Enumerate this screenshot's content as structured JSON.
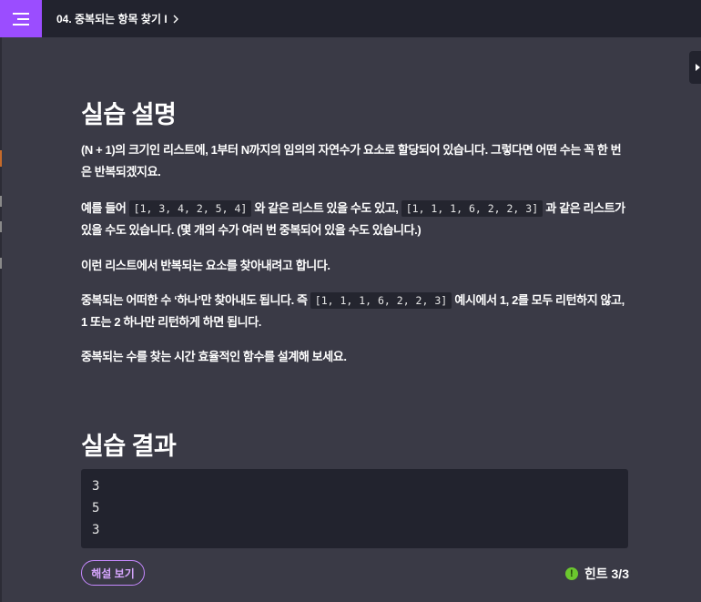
{
  "header": {
    "menu_icon": "hamburger-menu-icon",
    "breadcrumb_title": "04. 중복되는 항목 찾기 I",
    "breadcrumb_chevron": "›"
  },
  "description": {
    "heading": "실습 설명",
    "p1": "(N + 1)의 크기인 리스트에, 1부터 N까지의 임의의 자연수가 요소로 할당되어 있습니다. 그렇다면 어떤 수는 꼭 한 번은 반복되겠지요.",
    "p2_pre": "예를 들어",
    "p2_code1": "[1, 3, 4, 2, 5, 4]",
    "p2_mid": "와 같은 리스트 있을 수도 있고,",
    "p2_code2": "[1, 1, 1, 6, 2, 2, 3]",
    "p2_post": "과 같은 리스트가 있을 수도 있습니다. (몇 개의 수가 여러 번 중복되어 있을 수도 있습니다.)",
    "p3": "이런 리스트에서 반복되는 요소를 찾아내려고 합니다.",
    "p4_pre": "중복되는 어떠한 수 ‘하나’만 찾아내도 됩니다. 즉",
    "p4_code": "[1, 1, 1, 6, 2, 2, 3]",
    "p4_post": "예시에서 1, 2를 모두 리턴하지 않고, 1 또는 2 하나만 리턴하게 하면 됩니다.",
    "p5": "중복되는 수를 찾는 시간 효율적인 함수를 설계해 보세요."
  },
  "result": {
    "heading": "실습 결과",
    "lines": [
      "3",
      "5",
      "3"
    ]
  },
  "footer": {
    "solution_button": "해설 보기",
    "hint_label": "힌트 3/3",
    "hint_icon": "exclamation-circle-icon",
    "hint_color": "#6bc72e",
    "accent_color": "#9b4dff"
  }
}
